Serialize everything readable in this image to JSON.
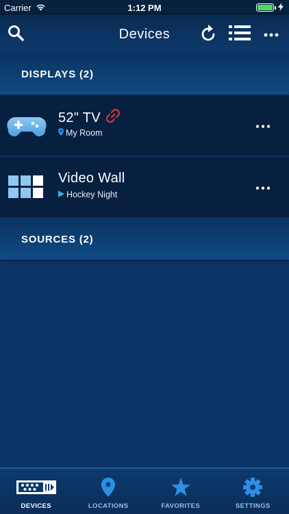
{
  "status_bar": {
    "carrier": "Carrier",
    "time": "1:12 PM",
    "battery_level": 1.0,
    "battery_color": "#4cd964"
  },
  "nav": {
    "title": "Devices",
    "left_icon": "search-icon",
    "right_icons": [
      "refresh-icon",
      "list-icon",
      "more-icon"
    ]
  },
  "displays_header": {
    "label": "DISPLAYS (2)"
  },
  "devices": [
    {
      "name": "52\" TV",
      "subtitle": "My Room",
      "icon": "gamepad-icon",
      "status_icon": "link-broken-icon",
      "sub_icon": "location-pin-icon"
    },
    {
      "name": "Video Wall",
      "subtitle": "Hockey Night",
      "icon": "grid-icon",
      "sub_icon": "play-icon"
    }
  ],
  "sources_header": {
    "label": "SOURCES (2)"
  },
  "tabs": [
    {
      "label": "DEVICES",
      "icon": "devices-icon",
      "active": true
    },
    {
      "label": "LOCATIONS",
      "icon": "location-icon",
      "active": false
    },
    {
      "label": "FAVORITES",
      "icon": "star-icon",
      "active": false
    },
    {
      "label": "SETTINGS",
      "icon": "gear-icon",
      "active": false
    }
  ],
  "colors": {
    "background": "#0c3466",
    "row_background": "#07203f",
    "accent": "#2b8fe6",
    "link_broken": "#e2323c",
    "tab_inactive": "#8fc0f0"
  }
}
